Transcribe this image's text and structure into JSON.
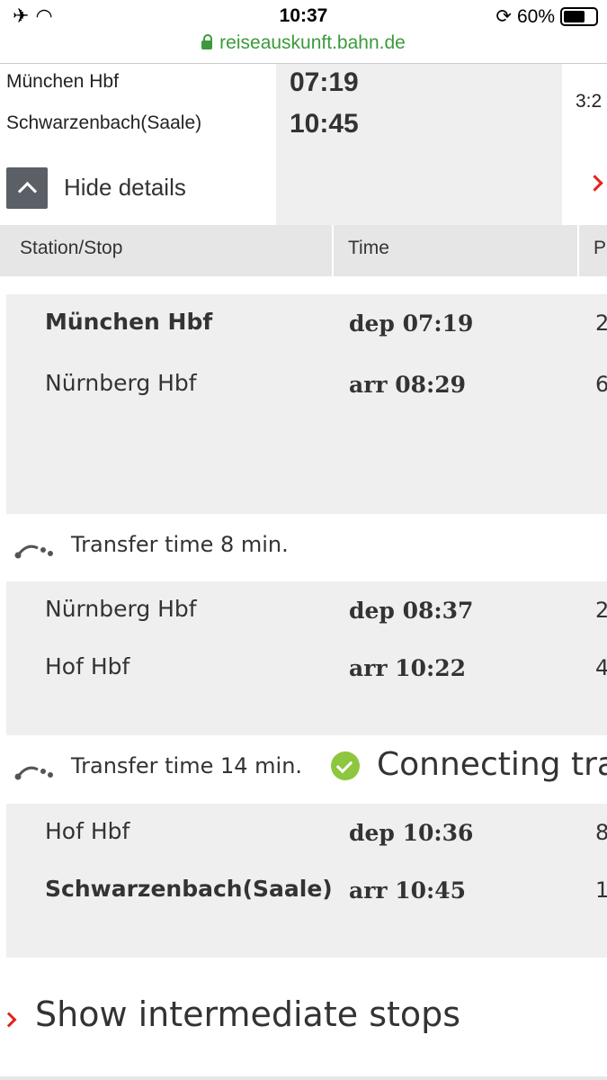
{
  "status_bar": {
    "time": "10:37",
    "battery": "60%",
    "battery_level": 0.6,
    "url": "reiseauskunft.bahn.de"
  },
  "summary": {
    "from_station": "München Hbf",
    "to_station": "Schwarzenbach(Saale)",
    "dep_time": "07:19",
    "arr_time": "10:45",
    "duration_partial": "3:2",
    "hide_details": "Hide details"
  },
  "table_header": {
    "station": "Station/Stop",
    "time": "Time",
    "platform_partial": "P"
  },
  "segments": [
    {
      "stops": [
        {
          "station": "München Hbf",
          "time": "dep 07:19",
          "platform": "2",
          "bold": true
        },
        {
          "station": "Nürnberg Hbf",
          "time": "arr 08:29",
          "platform": "6",
          "bold": false
        }
      ]
    },
    {
      "stops": [
        {
          "station": "Nürnberg Hbf",
          "time": "dep 08:37",
          "platform": "2",
          "bold": false
        },
        {
          "station": "Hof Hbf",
          "time": "arr 10:22",
          "platform": "4",
          "bold": false
        }
      ]
    },
    {
      "stops": [
        {
          "station": "Hof Hbf",
          "time": "dep 10:36",
          "platform": "8",
          "bold": false
        },
        {
          "station": "Schwarzenbach(Saale)",
          "time": "arr 10:45",
          "platform": "1",
          "bold": true
        }
      ]
    }
  ],
  "transfers": [
    {
      "label": "Transfer time 8 min."
    },
    {
      "label": "Transfer time 14 min.",
      "status": "Connecting tra"
    }
  ],
  "show_intermediate_stops": "Show intermediate stops",
  "colors": {
    "accent_red": "#e2231a",
    "url_green": "#3c9a3c",
    "check_green": "#8dc63f"
  }
}
